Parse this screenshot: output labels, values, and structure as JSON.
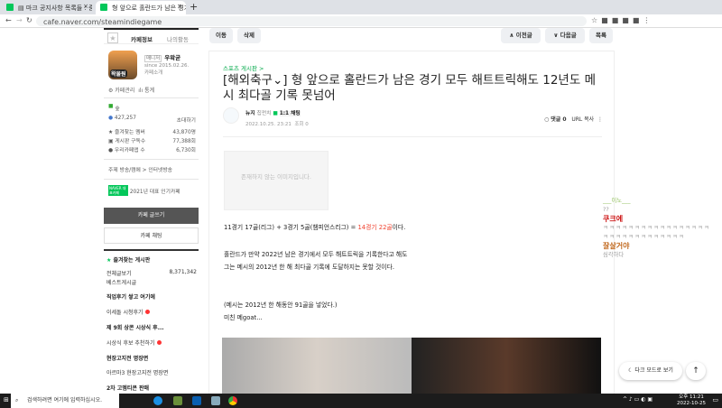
{
  "browser": {
    "tabs": [
      {
        "label": "▤ 마크 공지사항 목록들 : 중랑"
      },
      {
        "label": "형 앞으로 홀란드가 남은 경기 모"
      }
    ],
    "url": "cafe.naver.com/steamindiegame"
  },
  "sidebar": {
    "tab_info": "카페정보",
    "tab_activity": "나의활동",
    "manager_badge": "매니저",
    "manager_name": "우왁굳",
    "since": "since 2015.02.26.",
    "cafe_intro": "카페소개",
    "cafe_manage": "⚙ 카페관리",
    "stats": "ılı 통계",
    "level": "숲",
    "members": "427,257",
    "invite": "초대하기",
    "fav_members_label": "즐겨찾는 멤버",
    "fav_members": "43,870명",
    "board_subs_label": "게시판 구독수",
    "board_subs": "77,388회",
    "our_cafe_label": "우리카페앱 수",
    "our_cafe": "6,730회",
    "topic": "주제  방송/캠에 > 인터넷방송",
    "badge": "NAVER 대표카페",
    "award": "2021년 대표 인기카페",
    "write_button": "카페 글쓰기",
    "chat_button": "카페 채팅",
    "fav_board": "즐겨찾는 게시판",
    "nav": [
      {
        "label": "전체글보기",
        "count": "8,371,342"
      },
      {
        "label": "베스트게시글"
      },
      {
        "label": "직업후기 쌓고 여기에",
        "bold": true
      },
      {
        "label": "이세돌 시청후기",
        "dot": true
      },
      {
        "label": "제 9회 상콘 시상식 후...",
        "bold": true
      },
      {
        "label": "시상식 후보 추천하기",
        "dot": true
      },
      {
        "label": "현장고지전 명장면",
        "bold": true
      },
      {
        "label": "아르마3 현장고지전 명장면"
      },
      {
        "label": "2차 고멤티콘 판매",
        "bold": true
      }
    ]
  },
  "toolbar": {
    "move": "이동",
    "delete": "삭제",
    "prev": "∧ 이전글",
    "next": "∨ 다음글",
    "list": "목록"
  },
  "article": {
    "board": "스포츠 게시판 >",
    "title": "[해외축구⌄] 형 앞으로 홀란드가 남은 경기 모두 해트트릭해도 12년도 메시 최다골 기록 못넘어",
    "author": "뉴지",
    "author_level": "칩펀치",
    "chat": "1:1 채팅",
    "date": "2022.10.25. 23:21",
    "views": "조회 0",
    "comments": "댓글 0",
    "url_copy": "URL 복사",
    "missing_image": "존재하지 않는 이미지입니다.",
    "line1a": "11경기 17골(리그) + 3경기 5골(챔피언스리그) = ",
    "line1b": "14경기 22골",
    "line1c": "이다.",
    "line2": "홀란드가 만약 2022년 남은 경기에서 모두 해트트릭을 기록한다고 해도",
    "line3": "그는 메시의 2012년 한 해 최다골 기록에 도달하지는 못할 것이다.",
    "line4": "(메시는 2012년 한 해동안 91골을 넣었다.)",
    "line5": "미친 메goat..."
  },
  "comments": [
    {
      "name": "___이노___",
      "text": "??",
      "color": "#8fbf5a"
    },
    {
      "name": "쿠크에",
      "text": "ㅋㅋㅋㅋㅋㅋㅋㅋㅋㅋㅋㅋㅋㅋㅋㅋㅋㅋㅋㅋㅋㅋㅋㅋㅋㅋㅋㅋㅋㅋ",
      "color": "#cc1111"
    },
    {
      "name": "잘살거야",
      "text": "심각하다",
      "color": "#c0661a"
    }
  ],
  "dark_mode": "☾ 다크 모드로 보기",
  "taskbar": {
    "search": "검색하려면 여기에 입력하십시오.",
    "time": "오후 11:21",
    "date": "2022-10-25"
  },
  "colors": {
    "naver_green": "#03c75a",
    "highlight_red": "#f0412e"
  }
}
